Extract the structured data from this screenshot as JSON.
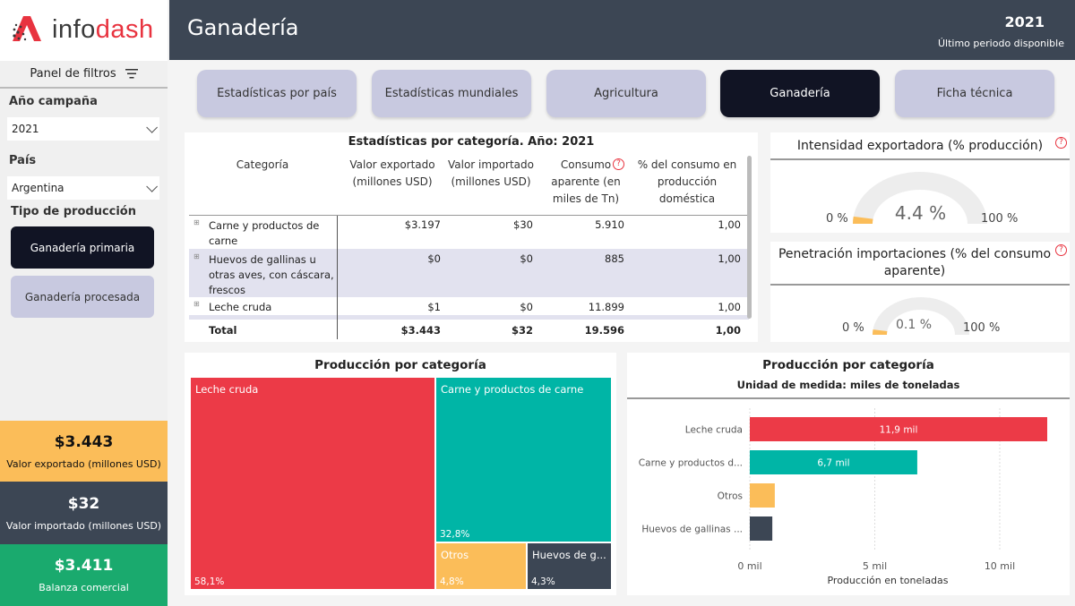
{
  "logo": {
    "text_a": "info",
    "text_b": "dash"
  },
  "sidebar": {
    "filter_panel": "Panel de filtros",
    "year_label": "Año campaña",
    "year_value": "2021",
    "country_label": "País",
    "country_value": "Argentina",
    "type_label": "Tipo de producción",
    "type_options": [
      "Ganadería primaria",
      "Ganadería procesada"
    ]
  },
  "kpis": [
    {
      "value": "$3.443",
      "label": "Valor exportado (millones USD)",
      "color": "#fbbd59"
    },
    {
      "value": "$32",
      "label": "Valor importado (millones USD)",
      "color": "#3c4654"
    },
    {
      "value": "$3.411",
      "label": "Balanza comercial",
      "color": "#1aaa6e"
    }
  ],
  "header": {
    "title": "Ganadería",
    "year": "2021",
    "period": "Último periodo disponible"
  },
  "tabs": [
    "Estadísticas por país",
    "Estadísticas mundiales",
    "Agricultura",
    "Ganadería",
    "Ficha técnica"
  ],
  "table": {
    "title": "Estadísticas por categoría. Año: 2021",
    "headers": [
      "Categoría",
      "Valor exportado (millones USD)",
      "Valor importado (millones USD)",
      "Consumo aparente (en miles de Tn)",
      "% del consumo en producción doméstica"
    ],
    "rows": [
      {
        "cat": "Carne y productos de carne",
        "exp": "$3.197",
        "imp": "$30",
        "cons": "5.910",
        "pct": "1,00"
      },
      {
        "cat": "Huevos de gallinas u otras aves, con cáscara, frescos",
        "exp": "$0",
        "imp": "$0",
        "cons": "885",
        "pct": "1,00"
      },
      {
        "cat": "Leche cruda",
        "exp": "$1",
        "imp": "$0",
        "cons": "11.899",
        "pct": "1,00"
      }
    ],
    "total": {
      "cat": "Total",
      "exp": "$3.443",
      "imp": "$32",
      "cons": "19.596",
      "pct": "1,00"
    }
  },
  "gauges": [
    {
      "title": "Intensidad exportadora (% producción)",
      "value_label": "4.4 %",
      "value": 4.4,
      "min_label": "0 %",
      "max_label": "100 %",
      "min": 0,
      "max": 100
    },
    {
      "title": "Penetración importaciones (% del consumo aparente)",
      "value_label": "0.1 %",
      "value": 0.1,
      "min_label": "0 %",
      "max_label": "100 %",
      "min": 0,
      "max": 100
    }
  ],
  "treemap": {
    "title": "Producción por categoría",
    "cells": [
      {
        "name": "Leche cruda",
        "pct": "58,1%",
        "color": "#ec3a47"
      },
      {
        "name": "Carne y productos de carne",
        "pct": "32,8%",
        "color": "#00b5a6"
      },
      {
        "name": "Otros",
        "pct": "4,8%",
        "color": "#fbbd59"
      },
      {
        "name": "Huevos de g...",
        "pct": "4,3%",
        "color": "#3c4654"
      }
    ]
  },
  "chart_data": {
    "type": "bar",
    "title": "Producción por categoría",
    "subtitle": "Unidad de medida: miles de toneladas",
    "xlabel": "Producción en toneladas",
    "categories": [
      "Leche cruda",
      "Carne y productos d...",
      "Otros",
      "Huevos de gallinas ..."
    ],
    "values": [
      11.9,
      6.7,
      1.0,
      0.9
    ],
    "data_labels": [
      "11,9 mil",
      "6,7 mil",
      "",
      ""
    ],
    "colors": [
      "#ec3a47",
      "#00b5a6",
      "#fbbd59",
      "#3c4654"
    ],
    "xticks": [
      "0 mil",
      "5 mil",
      "10 mil"
    ],
    "xtick_values": [
      0,
      5,
      10
    ],
    "xlim": [
      0,
      11.9
    ]
  }
}
